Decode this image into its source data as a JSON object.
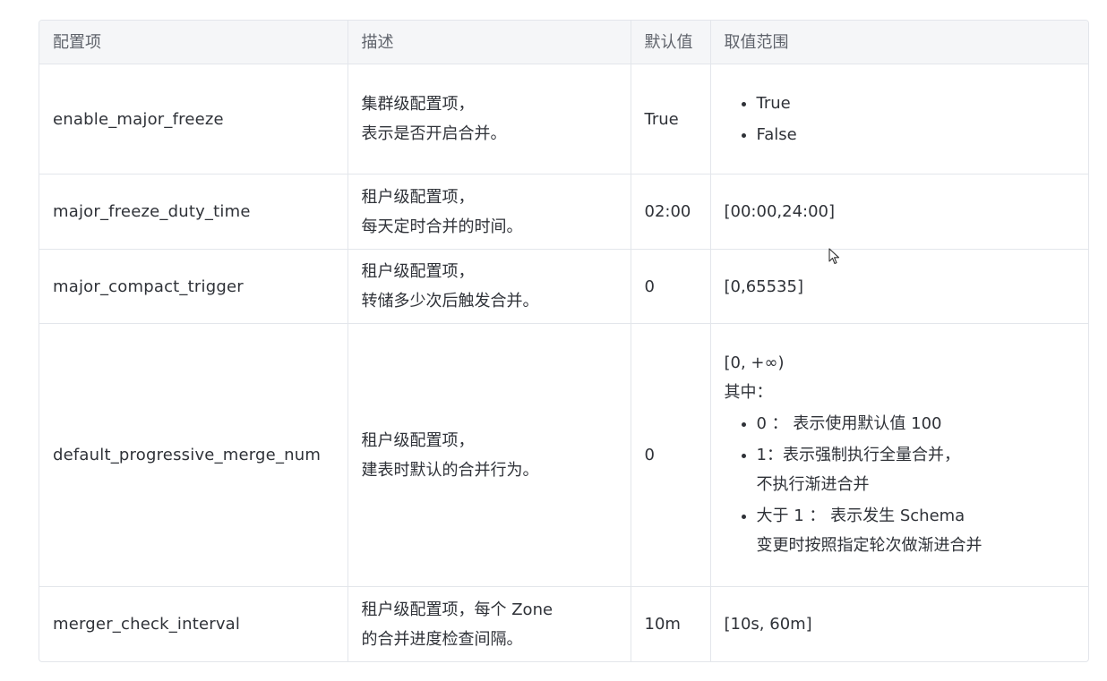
{
  "headers": {
    "name": "配置项",
    "desc": "描述",
    "default": "默认值",
    "range": "取值范围"
  },
  "rows": [
    {
      "name": "enable_major_freeze",
      "desc": [
        "集群级配置项，",
        "表示是否开启合并。"
      ],
      "default": "True",
      "range_intro": [],
      "range_items": [
        [
          "True"
        ],
        [
          "False"
        ]
      ]
    },
    {
      "name": "major_freeze_duty_time",
      "desc": [
        "租户级配置项，",
        "每天定时合并的时间。"
      ],
      "default": "02:00",
      "range_text": "[00:00,24:00]"
    },
    {
      "name": "major_compact_trigger",
      "desc": [
        "租户级配置项，",
        "转储多少次后触发合并。"
      ],
      "default": "0",
      "range_text": "[0,65535]"
    },
    {
      "name": "default_progressive_merge_num",
      "desc": [
        "租户级配置项，",
        "建表时默认的合并行为。"
      ],
      "default": "0",
      "range_intro": [
        "[0, +∞)",
        "其中："
      ],
      "range_items": [
        [
          "0 ： 表示使用默认值 100"
        ],
        [
          "1：表示强制执行全量合并，",
          "不执行渐进合并"
        ],
        [
          "大于 1 ： 表示发生 Schema",
          "变更时按照指定轮次做渐进合并"
        ]
      ]
    },
    {
      "name": "merger_check_interval",
      "desc": [
        "租户级配置项，每个 Zone",
        "的合并进度检查间隔。"
      ],
      "default": "10m",
      "range_text": "[10s, 60m]"
    }
  ]
}
